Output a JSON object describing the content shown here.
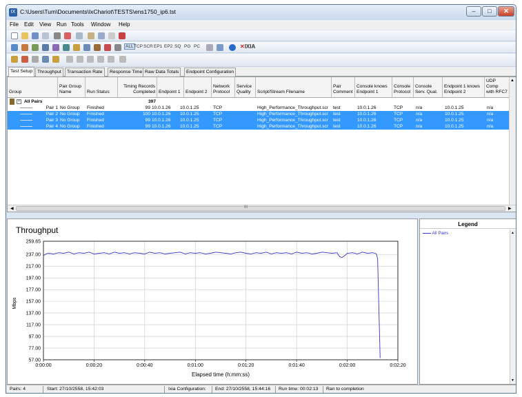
{
  "window": {
    "title": "C:\\Users\\Tum\\Documents\\IxChariot\\TESTS\\ens1750_ip6.tst",
    "app_icon": "ixchariot-app-icon",
    "minimize": "–",
    "maximize": "□",
    "close": "✕"
  },
  "menu": [
    "File",
    "Edit",
    "View",
    "Run",
    "Tools",
    "Window",
    "Help"
  ],
  "toolbar_protocols": [
    "ALL",
    "TCP",
    "SCR",
    "EP1",
    "EP2",
    "SQ",
    "PG",
    "PC"
  ],
  "brand": "IXIA",
  "tabs": [
    "Test Setup",
    "Throughput",
    "Transaction Rate",
    "Response Time",
    "Raw Data Totals",
    "Endpoint Configuration"
  ],
  "columns": [
    "Group",
    "Pair Group Name",
    "Run Status",
    "Timing Records Completed",
    "Endpoint 1",
    "Endpoint 2",
    "Network Protocol",
    "Service Quality",
    "Script/Stream Filename",
    "Pair Comment",
    "Console knows Endpoint 1",
    "Console Protocol",
    "Console Serv. Qual.",
    "Endpoint 1 knows Endpoint 2",
    "UDP Comp with RFC7"
  ],
  "group_row": {
    "label": "All Pairs",
    "records": "397"
  },
  "pairs": [
    {
      "pair": "Pair 1",
      "group": "No Group",
      "status": "Finished",
      "records": "99",
      "ep1": "10.0.1.26",
      "ep2": "10.0.1.25",
      "proto": "TCP",
      "qos": "",
      "script": "High_Performance_Throughput.scr",
      "comment": "test",
      "knows1": "10.0.1.26",
      "cproto": "TCP",
      "cqos": "n/a",
      "knows2": "10.0.1.25",
      "udp": "n/a"
    },
    {
      "pair": "Pair 2",
      "group": "No Group",
      "status": "Finished",
      "records": "100",
      "ep1": "10.0.1.26",
      "ep2": "10.0.1.25",
      "proto": "TCP",
      "qos": "",
      "script": "High_Performance_Throughput.scr",
      "comment": "test",
      "knows1": "10.0.1.26",
      "cproto": "TCP",
      "cqos": "n/a",
      "knows2": "10.0.1.25",
      "udp": "n/a"
    },
    {
      "pair": "Pair 3",
      "group": "No Group",
      "status": "Finished",
      "records": "99",
      "ep1": "10.0.1.26",
      "ep2": "10.0.1.25",
      "proto": "TCP",
      "qos": "",
      "script": "High_Performance_Throughput.scr",
      "comment": "test",
      "knows1": "10.0.1.26",
      "cproto": "TCP",
      "cqos": "n/a",
      "knows2": "10.0.1.25",
      "udp": "n/a"
    },
    {
      "pair": "Pair 4",
      "group": "No Group",
      "status": "Finished",
      "records": "99",
      "ep1": "10.0.1.26",
      "ep2": "10.0.1.25",
      "proto": "TCP",
      "qos": "",
      "script": "High_Performance_Throughput.scr",
      "comment": "test",
      "knows1": "10.0.1.26",
      "cproto": "TCP",
      "cqos": "n/a",
      "knows2": "10.0.1.25",
      "udp": "n/a"
    }
  ],
  "scroll_grip": "III",
  "legend": {
    "title": "Legend",
    "items": [
      "All Pairs"
    ]
  },
  "status": {
    "pairs": "Pairs: 4",
    "start": "Start: 27/10/2558, 15:42:03",
    "config": "Ixia Configuration:",
    "end": "End: 27/10/2558, 15:44:16",
    "runtime": "Run time: 00:02:13",
    "result": "Ran to completion"
  },
  "colors": {
    "selection": "#3399ff",
    "series": "#3333cc"
  },
  "chart_data": {
    "type": "line",
    "title": "Throughput",
    "xlabel": "Elapsed time (h:mm:ss)",
    "ylabel": "Mbps",
    "ylim": [
      57.0,
      259.65
    ],
    "xlim": [
      0,
      140
    ],
    "x_ticks": [
      "0:00:00",
      "0:00:20",
      "0:00:40",
      "0:01:00",
      "0:01:20",
      "0:01:40",
      "0:02:00",
      "0:02:20"
    ],
    "y_ticks": [
      "259.65",
      "237.00",
      "217.00",
      "197.00",
      "177.00",
      "157.00",
      "137.00",
      "117.00",
      "97.00",
      "77.00",
      "57.00"
    ],
    "grid": true,
    "series": [
      {
        "name": "All Pairs",
        "x": [
          0,
          1,
          2,
          4,
          6,
          8,
          10,
          12,
          14,
          16,
          18,
          20,
          22,
          24,
          26,
          28,
          30,
          32,
          34,
          36,
          38,
          40,
          42,
          44,
          46,
          48,
          50,
          52,
          54,
          56,
          58,
          60,
          62,
          64,
          66,
          68,
          70,
          72,
          74,
          76,
          78,
          80,
          82,
          84,
          86,
          88,
          90,
          92,
          94,
          96,
          98,
          100,
          102,
          104,
          106,
          108,
          110,
          112,
          114,
          116,
          117,
          118,
          119,
          120,
          122,
          124,
          126,
          128,
          130,
          131,
          131.5,
          132,
          133
        ],
        "y": [
          235,
          238,
          239,
          238,
          240,
          239,
          241,
          238,
          240,
          239,
          241,
          238,
          239,
          240,
          238,
          241,
          239,
          240,
          238,
          240,
          239,
          238,
          241,
          239,
          240,
          238,
          239,
          240,
          241,
          238,
          240,
          239,
          240,
          238,
          239,
          241,
          240,
          239,
          238,
          240,
          241,
          239,
          238,
          240,
          239,
          241,
          238,
          240,
          239,
          240,
          238,
          241,
          239,
          240,
          238,
          239,
          241,
          240,
          239,
          240,
          233,
          232,
          235,
          239,
          240,
          238,
          241,
          239,
          240,
          239,
          238,
          230,
          60
        ]
      }
    ]
  }
}
